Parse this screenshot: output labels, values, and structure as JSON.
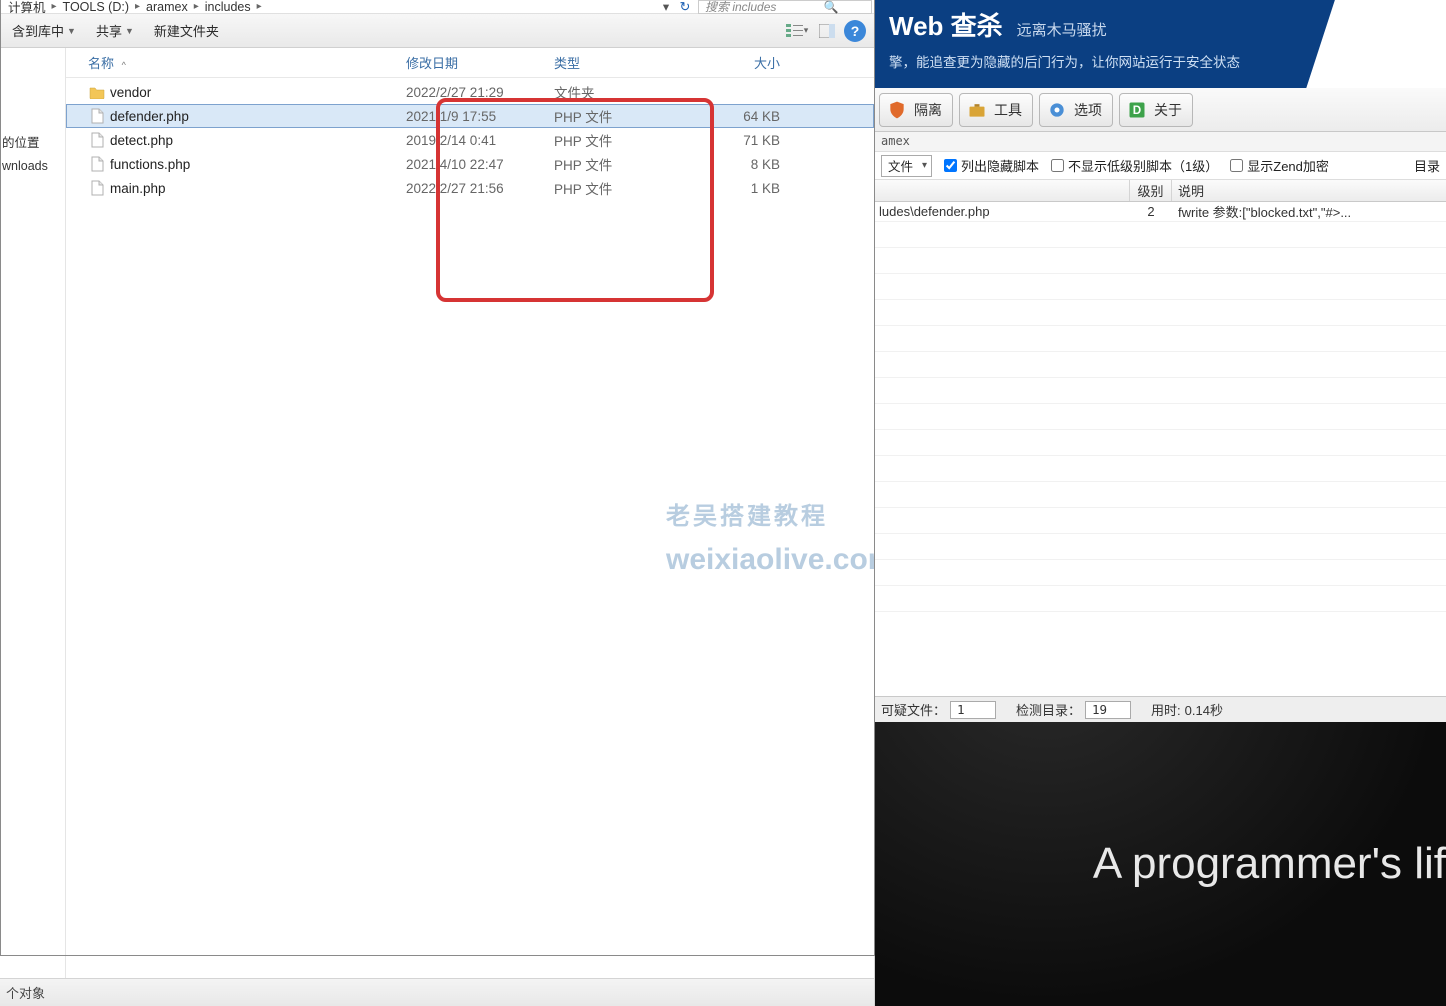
{
  "explorer": {
    "breadcrumbs": [
      "计算机",
      "TOOLS (D:)",
      "aramex",
      "includes"
    ],
    "search_placeholder": "搜索 includes",
    "toolbar": {
      "include_lib": "含到库中",
      "share": "共享",
      "new_folder": "新建文件夹"
    },
    "columns": {
      "name": "名称",
      "date": "修改日期",
      "type": "类型",
      "size": "大小"
    },
    "nav": {
      "item1": "的位置",
      "item2": "wnloads"
    },
    "files": [
      {
        "name": "vendor",
        "date": "2022/2/27 21:29",
        "type": "文件夹",
        "size": "",
        "kind": "folder",
        "selected": false
      },
      {
        "name": "defender.php",
        "date": "2021/1/9 17:55",
        "type": "PHP 文件",
        "size": "64 KB",
        "kind": "file",
        "selected": true
      },
      {
        "name": "detect.php",
        "date": "2019/2/14 0:41",
        "type": "PHP 文件",
        "size": "71 KB",
        "kind": "file",
        "selected": false
      },
      {
        "name": "functions.php",
        "date": "2021/4/10 22:47",
        "type": "PHP 文件",
        "size": "8 KB",
        "kind": "file",
        "selected": false
      },
      {
        "name": "main.php",
        "date": "2022/2/27 21:56",
        "type": "PHP 文件",
        "size": "1 KB",
        "kind": "file",
        "selected": false
      }
    ],
    "status": "个对象",
    "watermark": {
      "line1": "老吴搭建教程",
      "line2": "weixiaolive.com"
    }
  },
  "scanner": {
    "title_prefix": "Web",
    "title_main": "查杀",
    "title_sub": "远离木马骚扰",
    "desc": "擎，能追查更为隐藏的后门行为，让你网站运行于安全状态",
    "buttons": {
      "isolate": "隔离",
      "tools": "工具",
      "options": "选项",
      "about": "关于"
    },
    "path": "amex",
    "opts": {
      "filetype": "文件",
      "chk_hidden": "列出隐藏脚本",
      "chk_lowlevel": "不显示低级别脚本（1级）",
      "chk_zend": "显示Zend加密",
      "dir_label": "目录"
    },
    "grid": {
      "col_level": "级别",
      "col_desc": "说明"
    },
    "rows": [
      {
        "path": "ludes\\defender.php",
        "level": "2",
        "desc": "fwrite 参数:[\"blocked.txt\",\"#>..."
      }
    ],
    "status": {
      "susp_label": "可疑文件：",
      "susp_val": "1",
      "dirs_label": "检测目录：",
      "dirs_val": "19",
      "time_label": "用时:",
      "time_val": "0.14秒"
    }
  },
  "promo": {
    "text": "A programmer's lif"
  }
}
